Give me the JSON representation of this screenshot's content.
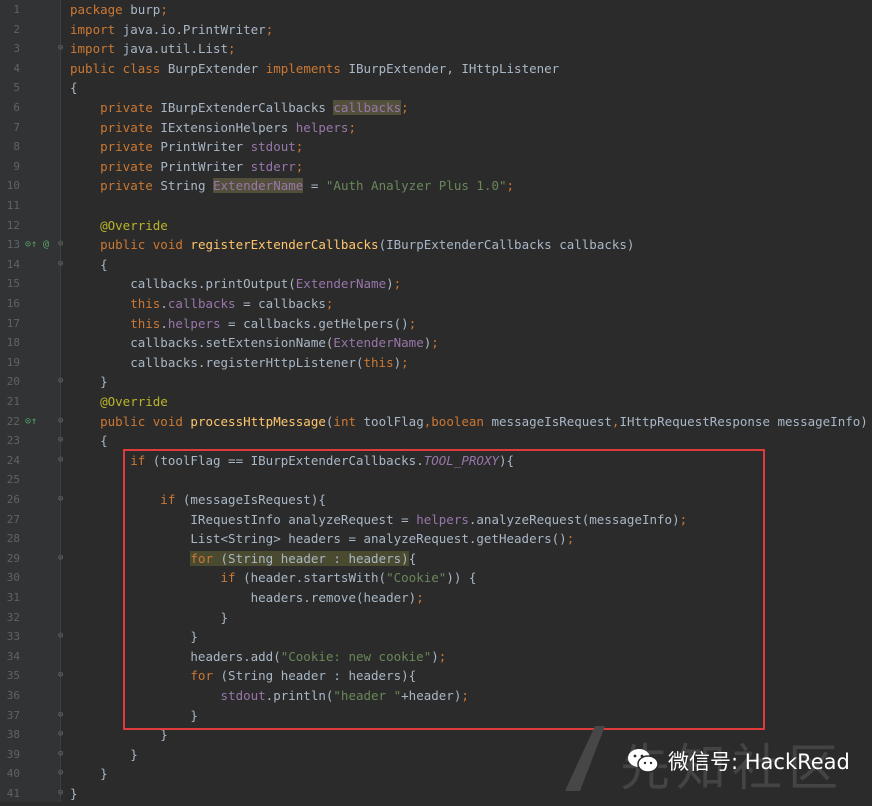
{
  "editor": {
    "gutter_icons": {
      "line13": "override-implement-icon",
      "line22": "implement-icon"
    },
    "lines": [
      {
        "n": "1",
        "segs": [
          {
            "t": "package ",
            "c": "kw"
          },
          {
            "t": "burp",
            "c": ""
          },
          {
            "t": ";",
            "c": "kw"
          }
        ]
      },
      {
        "n": "2",
        "segs": [
          {
            "t": "import ",
            "c": "kw"
          },
          {
            "t": "java.io.PrintWriter",
            "c": ""
          },
          {
            "t": ";",
            "c": "kw"
          }
        ]
      },
      {
        "n": "3",
        "segs": [
          {
            "t": "import ",
            "c": "kw"
          },
          {
            "t": "java.util.List",
            "c": ""
          },
          {
            "t": ";",
            "c": "kw"
          }
        ]
      },
      {
        "n": "4",
        "segs": [
          {
            "t": "public class ",
            "c": "kw"
          },
          {
            "t": "BurpExtender ",
            "c": ""
          },
          {
            "t": "implements ",
            "c": "kw"
          },
          {
            "t": "IBurpExtender, IHttpListener",
            "c": ""
          }
        ]
      },
      {
        "n": "5",
        "segs": [
          {
            "t": "{",
            "c": ""
          }
        ]
      },
      {
        "n": "6",
        "segs": [
          {
            "t": "    private ",
            "c": "kw"
          },
          {
            "t": "IBurpExtenderCallbacks ",
            "c": ""
          },
          {
            "t": "callbacks",
            "c": "fld hl"
          },
          {
            "t": ";",
            "c": "kw"
          }
        ]
      },
      {
        "n": "7",
        "segs": [
          {
            "t": "    private ",
            "c": "kw"
          },
          {
            "t": "IExtensionHelpers ",
            "c": ""
          },
          {
            "t": "helpers",
            "c": "fld"
          },
          {
            "t": ";",
            "c": "kw"
          }
        ]
      },
      {
        "n": "8",
        "segs": [
          {
            "t": "    private ",
            "c": "kw"
          },
          {
            "t": "PrintWriter ",
            "c": ""
          },
          {
            "t": "stdout",
            "c": "fld"
          },
          {
            "t": ";",
            "c": "kw"
          }
        ]
      },
      {
        "n": "9",
        "segs": [
          {
            "t": "    private ",
            "c": "kw"
          },
          {
            "t": "PrintWriter ",
            "c": ""
          },
          {
            "t": "stderr",
            "c": "fld"
          },
          {
            "t": ";",
            "c": "kw"
          }
        ]
      },
      {
        "n": "10",
        "segs": [
          {
            "t": "    private ",
            "c": "kw"
          },
          {
            "t": "String ",
            "c": ""
          },
          {
            "t": "ExtenderName",
            "c": "fld hl"
          },
          {
            "t": " = ",
            "c": ""
          },
          {
            "t": "\"Auth Analyzer Plus 1.0\"",
            "c": "str"
          },
          {
            "t": ";",
            "c": "kw"
          }
        ]
      },
      {
        "n": "11",
        "segs": []
      },
      {
        "n": "12",
        "segs": [
          {
            "t": "    @Override",
            "c": "ann"
          }
        ]
      },
      {
        "n": "13",
        "segs": [
          {
            "t": "    public void ",
            "c": "kw"
          },
          {
            "t": "registerExtenderCallbacks",
            "c": "fn"
          },
          {
            "t": "(IBurpExtenderCallbacks callbacks)",
            "c": ""
          }
        ]
      },
      {
        "n": "14",
        "segs": [
          {
            "t": "    {",
            "c": ""
          }
        ]
      },
      {
        "n": "15",
        "segs": [
          {
            "t": "        callbacks.printOutput(",
            "c": ""
          },
          {
            "t": "ExtenderName",
            "c": "fld"
          },
          {
            "t": ")",
            "c": ""
          },
          {
            "t": ";",
            "c": "kw"
          }
        ]
      },
      {
        "n": "16",
        "segs": [
          {
            "t": "        this",
            "c": "kw"
          },
          {
            "t": ".",
            "c": ""
          },
          {
            "t": "callbacks",
            "c": "fld"
          },
          {
            "t": " = callbacks",
            "c": ""
          },
          {
            "t": ";",
            "c": "kw"
          }
        ]
      },
      {
        "n": "17",
        "segs": [
          {
            "t": "        this",
            "c": "kw"
          },
          {
            "t": ".",
            "c": ""
          },
          {
            "t": "helpers",
            "c": "fld"
          },
          {
            "t": " = callbacks.getHelpers()",
            "c": ""
          },
          {
            "t": ";",
            "c": "kw"
          }
        ]
      },
      {
        "n": "18",
        "segs": [
          {
            "t": "        callbacks.setExtensionName(",
            "c": ""
          },
          {
            "t": "ExtenderName",
            "c": "fld"
          },
          {
            "t": ")",
            "c": ""
          },
          {
            "t": ";",
            "c": "kw"
          }
        ]
      },
      {
        "n": "19",
        "segs": [
          {
            "t": "        callbacks.registerHttpListener(",
            "c": ""
          },
          {
            "t": "this",
            "c": "kw"
          },
          {
            "t": ")",
            "c": ""
          },
          {
            "t": ";",
            "c": "kw"
          }
        ]
      },
      {
        "n": "20",
        "segs": [
          {
            "t": "    }",
            "c": ""
          }
        ]
      },
      {
        "n": "21",
        "segs": [
          {
            "t": "    @Override",
            "c": "ann"
          }
        ]
      },
      {
        "n": "22",
        "segs": [
          {
            "t": "    public void ",
            "c": "kw"
          },
          {
            "t": "processHttpMessage",
            "c": "fn"
          },
          {
            "t": "(",
            "c": ""
          },
          {
            "t": "int ",
            "c": "kw"
          },
          {
            "t": "toolFlag",
            "c": ""
          },
          {
            "t": ",",
            "c": "kw"
          },
          {
            "t": "boolean ",
            "c": "kw"
          },
          {
            "t": "messageIsRequest",
            "c": ""
          },
          {
            "t": ",",
            "c": "kw"
          },
          {
            "t": "IHttpRequestResponse messageInfo)",
            "c": ""
          }
        ]
      },
      {
        "n": "23",
        "segs": [
          {
            "t": "    {",
            "c": ""
          }
        ]
      },
      {
        "n": "24",
        "segs": [
          {
            "t": "        if ",
            "c": "kw"
          },
          {
            "t": "(toolFlag == IBurpExtenderCallbacks.",
            "c": ""
          },
          {
            "t": "TOOL_PROXY",
            "c": "it"
          },
          {
            "t": "){",
            "c": ""
          }
        ]
      },
      {
        "n": "25",
        "segs": []
      },
      {
        "n": "26",
        "segs": [
          {
            "t": "            if ",
            "c": "kw"
          },
          {
            "t": "(messageIsRequest){",
            "c": ""
          }
        ]
      },
      {
        "n": "27",
        "segs": [
          {
            "t": "                IRequestInfo analyzeRequest = ",
            "c": ""
          },
          {
            "t": "helpers",
            "c": "fld"
          },
          {
            "t": ".analyzeRequest(messageInfo)",
            "c": ""
          },
          {
            "t": ";",
            "c": "kw"
          }
        ]
      },
      {
        "n": "28",
        "segs": [
          {
            "t": "                List<String> headers = analyzeRequest.getHeaders()",
            "c": ""
          },
          {
            "t": ";",
            "c": "kw"
          }
        ]
      },
      {
        "n": "29",
        "segs": [
          {
            "t": "                ",
            "c": ""
          },
          {
            "t": "for ",
            "c": "kw hl2"
          },
          {
            "t": "(String header : headers)",
            "c": "hl2"
          },
          {
            "t": "{",
            "c": ""
          }
        ]
      },
      {
        "n": "30",
        "segs": [
          {
            "t": "                    if ",
            "c": "kw"
          },
          {
            "t": "(header.startsWith(",
            "c": ""
          },
          {
            "t": "\"Cookie\"",
            "c": "str"
          },
          {
            "t": ")) {",
            "c": ""
          }
        ]
      },
      {
        "n": "31",
        "segs": [
          {
            "t": "                        headers.remove(header)",
            "c": ""
          },
          {
            "t": ";",
            "c": "kw"
          }
        ]
      },
      {
        "n": "32",
        "segs": [
          {
            "t": "                    }",
            "c": ""
          }
        ]
      },
      {
        "n": "33",
        "segs": [
          {
            "t": "                }",
            "c": ""
          }
        ]
      },
      {
        "n": "34",
        "segs": [
          {
            "t": "                headers.add(",
            "c": ""
          },
          {
            "t": "\"Cookie: new cookie\"",
            "c": "str"
          },
          {
            "t": ")",
            "c": ""
          },
          {
            "t": ";",
            "c": "kw"
          }
        ]
      },
      {
        "n": "35",
        "segs": [
          {
            "t": "                for ",
            "c": "kw"
          },
          {
            "t": "(String header : headers){",
            "c": ""
          }
        ]
      },
      {
        "n": "36",
        "segs": [
          {
            "t": "                    ",
            "c": ""
          },
          {
            "t": "stdout",
            "c": "fld"
          },
          {
            "t": ".println(",
            "c": ""
          },
          {
            "t": "\"header \"",
            "c": "str"
          },
          {
            "t": "+header)",
            "c": ""
          },
          {
            "t": ";",
            "c": "kw"
          }
        ]
      },
      {
        "n": "37",
        "segs": [
          {
            "t": "                }",
            "c": ""
          }
        ]
      },
      {
        "n": "38",
        "segs": [
          {
            "t": "            }",
            "c": ""
          }
        ]
      },
      {
        "n": "39",
        "segs": [
          {
            "t": "        }",
            "c": ""
          }
        ]
      },
      {
        "n": "40",
        "segs": [
          {
            "t": "    }",
            "c": ""
          }
        ]
      },
      {
        "n": "41",
        "segs": [
          {
            "t": "}",
            "c": ""
          }
        ]
      }
    ]
  },
  "watermark": {
    "cn": "先知社区"
  },
  "wechat": {
    "label": "微信号: HackRead",
    "icon": "wechat-icon"
  }
}
